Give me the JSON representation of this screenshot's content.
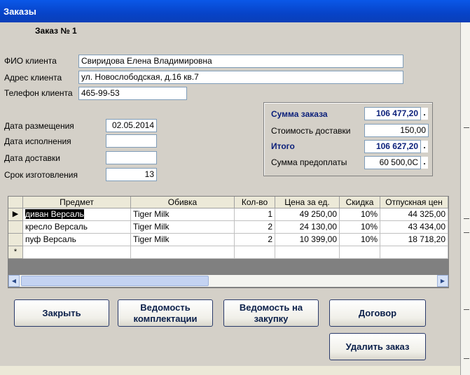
{
  "window": {
    "title": "Заказы"
  },
  "order": {
    "heading": "Заказ № 1"
  },
  "client": {
    "name_label": "ФИО клиента",
    "name_value": "Свиридова Елена Владимировна",
    "address_label": "Адрес клиента",
    "address_value": "ул. Новослободская, д.16 кв.7",
    "phone_label": "Телефон клиента",
    "phone_value": "465-99-53"
  },
  "dates": {
    "placed_label": "Дата размещения",
    "placed_value": "02.05.2014",
    "completed_label": "Дата исполнения",
    "completed_value": "",
    "delivery_label": "Дата доставки",
    "delivery_value": "",
    "term_label": "Срок изготовления",
    "term_value": "13"
  },
  "summary": {
    "order_sum_label": "Сумма заказа",
    "order_sum_value": "106 477,20",
    "delivery_cost_label": "Стоимость доставки",
    "delivery_cost_value": "150,00",
    "total_label": "Итого",
    "total_value": "106 627,20",
    "prepay_label": "Сумма предоплаты",
    "prepay_value": "60 500,0С",
    "dot": "."
  },
  "grid": {
    "columns": [
      "Предмет",
      "Обивка",
      "Кол-во",
      "Цена за ед.",
      "Скидка",
      "Отпускная цен"
    ],
    "rows": [
      [
        "диван Версаль",
        "Tiger Milk",
        "1",
        "49 250,00",
        "10%",
        "44 325,00"
      ],
      [
        "кресло Версаль",
        "Tiger Milk",
        "2",
        "24 130,00",
        "10%",
        "43 434,00"
      ],
      [
        "пуф Версаль",
        "Tiger Milk",
        "2",
        "10 399,00",
        "10%",
        "18 718,20"
      ]
    ],
    "current_row_marker": "▶",
    "new_row_marker": "*",
    "scroll_left": "◀",
    "scroll_right": "▶"
  },
  "buttons": {
    "close": "Закрыть",
    "bom_1": "Ведомость",
    "bom_2": "комплектации",
    "purchase_1": "Ведомость на",
    "purchase_2": "закупку",
    "contract": "Договор",
    "delete": "Удалить заказ"
  }
}
